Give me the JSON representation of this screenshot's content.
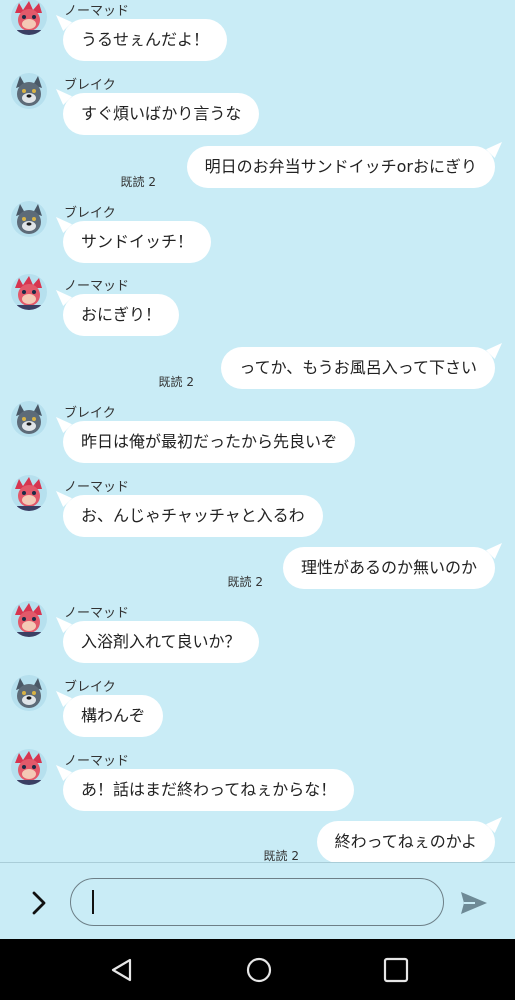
{
  "colors": {
    "background": "#c9ecf6",
    "bubble": "#ffffff",
    "navbar": "#000000",
    "send": "#6e8a96"
  },
  "messages": [
    {
      "side": "left",
      "name": "ノーマッド",
      "avatar": "nomad-avatar",
      "text": "うるせぇんだよ！"
    },
    {
      "side": "left",
      "name": "ブレイク",
      "avatar": "break-avatar",
      "text": "すぐ煩いばかり言うな"
    },
    {
      "side": "right",
      "text": "明日のお弁当サンドイッチorおにぎり",
      "read": "既読 2"
    },
    {
      "side": "left",
      "name": "ブレイク",
      "avatar": "break-avatar",
      "text": "サンドイッチ！"
    },
    {
      "side": "left",
      "name": "ノーマッド",
      "avatar": "nomad-avatar",
      "text": "おにぎり！"
    },
    {
      "side": "right",
      "text": "ってか、もうお風呂入って下さい",
      "read": "既読 2"
    },
    {
      "side": "left",
      "name": "ブレイク",
      "avatar": "break-avatar",
      "text": "昨日は俺が最初だったから先良いぞ"
    },
    {
      "side": "left",
      "name": "ノーマッド",
      "avatar": "nomad-avatar",
      "text": "お、んじゃチャッチャと入るわ"
    },
    {
      "side": "right",
      "text": "理性があるのか無いのか",
      "read": "既読 2"
    },
    {
      "side": "left",
      "name": "ノーマッド",
      "avatar": "nomad-avatar",
      "text": "入浴剤入れて良いか？"
    },
    {
      "side": "left",
      "name": "ブレイク",
      "avatar": "break-avatar",
      "text": "構わんぞ"
    },
    {
      "side": "left",
      "name": "ノーマッド",
      "avatar": "nomad-avatar",
      "text": "あ！話はまだ終わってねぇからな！"
    },
    {
      "side": "right",
      "text": "終わってねぇのかよ",
      "read": "既読 2"
    }
  ],
  "input": {
    "value": "",
    "menu_icon": "chevron-right-icon",
    "send_icon": "send-icon"
  },
  "navbar": {
    "back_icon": "back-triangle-icon",
    "home_icon": "home-circle-icon",
    "recents_icon": "recents-square-icon"
  }
}
